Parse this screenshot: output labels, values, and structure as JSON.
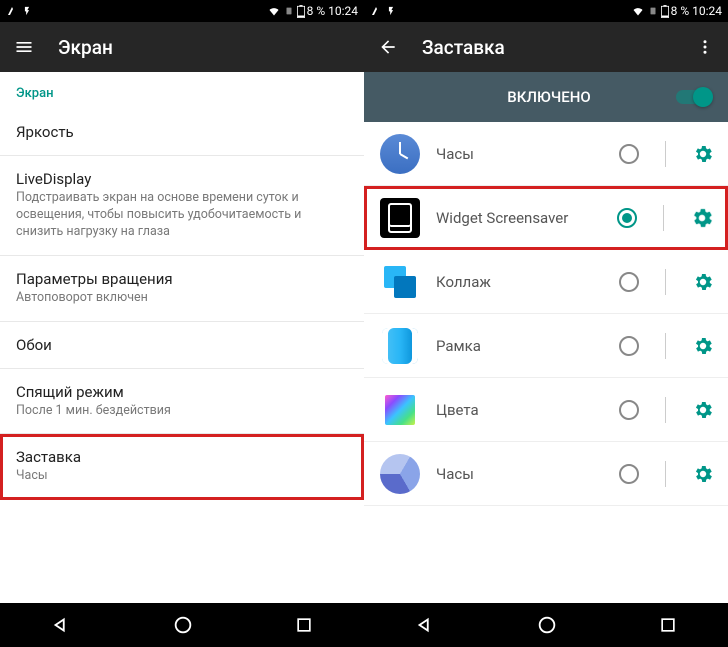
{
  "status": {
    "battery_pct": "8 %",
    "time": "10:24"
  },
  "left": {
    "title": "Экран",
    "section": "Экран",
    "items": [
      {
        "title": "Яркость",
        "sub": ""
      },
      {
        "title": "LiveDisplay",
        "sub": "Подстраивать экран на основе времени суток и освещения, чтобы повысить удобочитаемость и снизить нагрузку на глаза"
      },
      {
        "title": "Параметры вращения",
        "sub": "Автоповорот включен"
      },
      {
        "title": "Обои",
        "sub": ""
      },
      {
        "title": "Спящий режим",
        "sub": "После 1 мин. бездействия"
      },
      {
        "title": "Заставка",
        "sub": "Часы"
      }
    ]
  },
  "right": {
    "title": "Заставка",
    "toggle_label": "ВКЛЮЧЕНО",
    "items": [
      {
        "label": "Часы"
      },
      {
        "label": "Widget Screensaver"
      },
      {
        "label": "Коллаж"
      },
      {
        "label": "Рамка"
      },
      {
        "label": "Цвета"
      },
      {
        "label": "Часы"
      }
    ]
  }
}
